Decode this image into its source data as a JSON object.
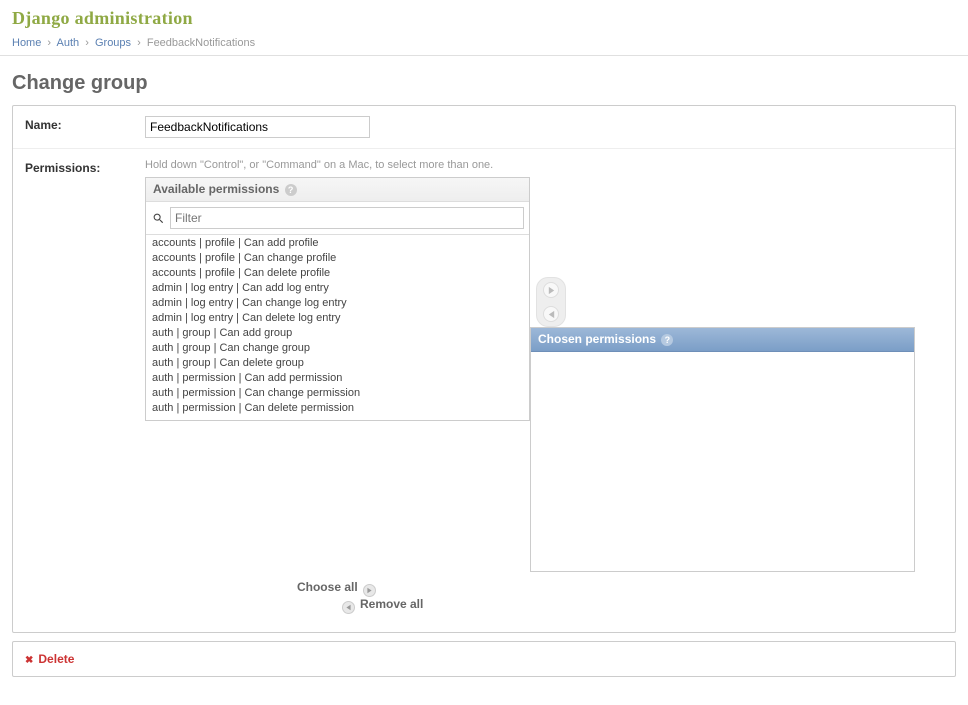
{
  "header": {
    "site_title": "Django administration"
  },
  "breadcrumbs": {
    "home": "Home",
    "auth": "Auth",
    "groups": "Groups",
    "current": "FeedbackNotifications"
  },
  "page_title": "Change group",
  "form": {
    "name_label": "Name:",
    "name_value": "FeedbackNotifications",
    "permissions_label": "Permissions:",
    "permissions_help": "Hold down \"Control\", or \"Command\" on a Mac, to select more than one."
  },
  "selector": {
    "available_heading": "Available permissions",
    "chosen_heading": "Chosen permissions",
    "filter_placeholder": "Filter",
    "available_items": [
      "accounts | profile | Can add profile",
      "accounts | profile | Can change profile",
      "accounts | profile | Can delete profile",
      "admin | log entry | Can add log entry",
      "admin | log entry | Can change log entry",
      "admin | log entry | Can delete log entry",
      "auth | group | Can add group",
      "auth | group | Can change group",
      "auth | group | Can delete group",
      "auth | permission | Can add permission",
      "auth | permission | Can change permission",
      "auth | permission | Can delete permission"
    ],
    "choose_all": "Choose all",
    "remove_all": "Remove all"
  },
  "delete_label": "Delete"
}
